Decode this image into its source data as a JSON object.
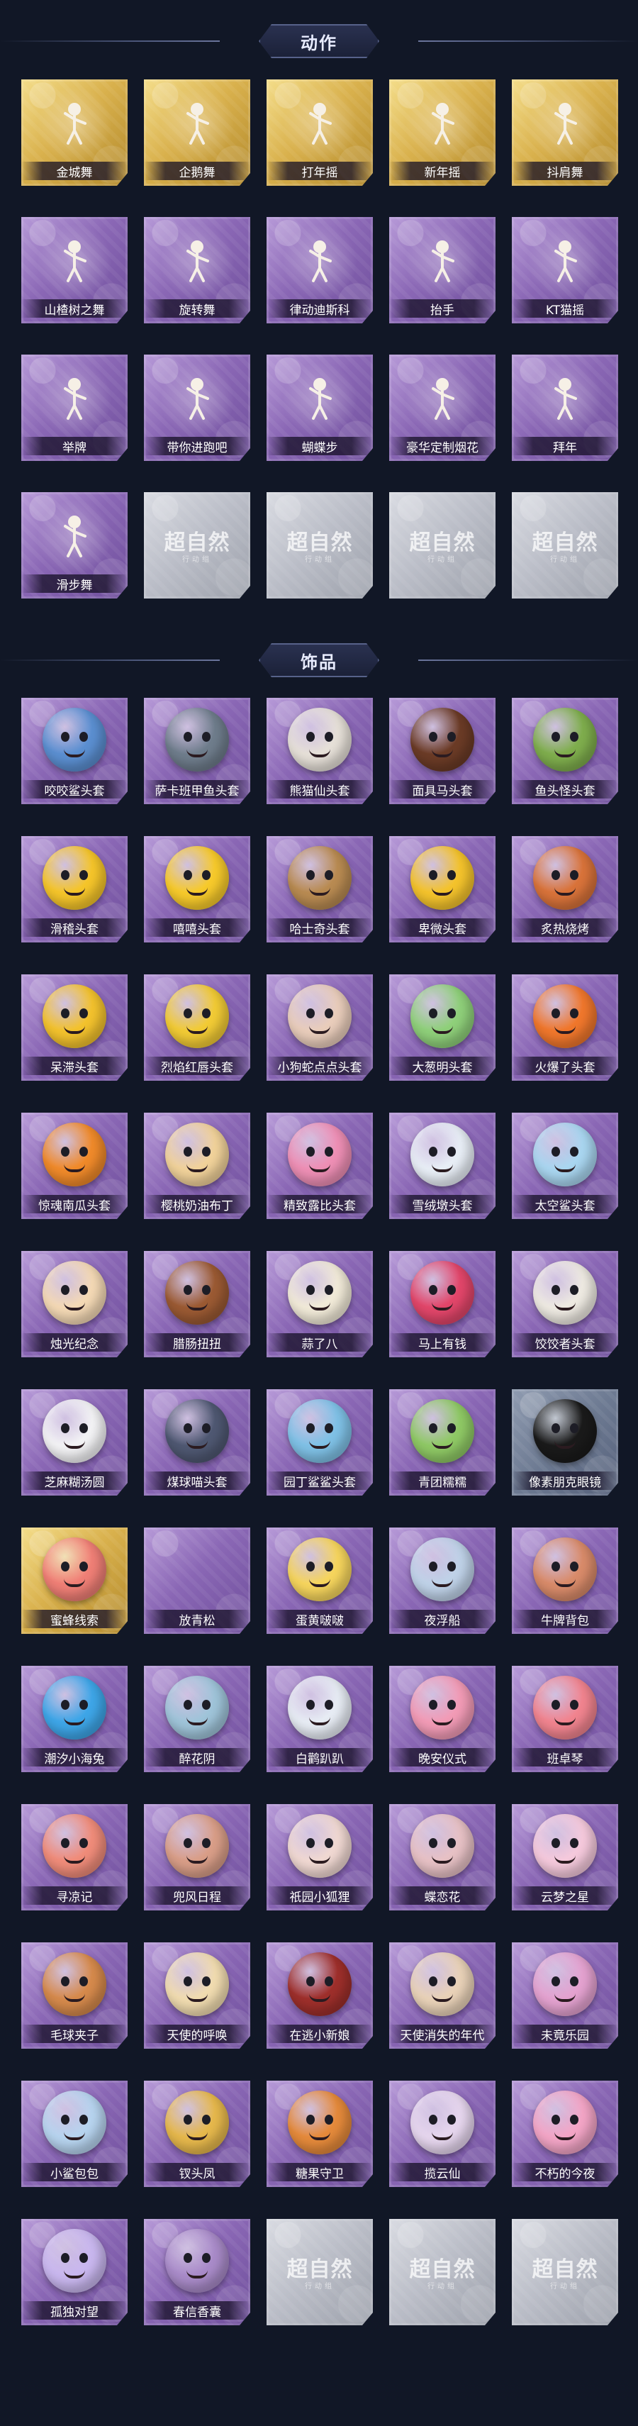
{
  "colors": {
    "background": "#111726",
    "card_purple": "#8a67b5",
    "card_gold": "#d9b14d",
    "card_silver": "#b9bcc6",
    "label_text": "#ffffff"
  },
  "sections": {
    "actions": {
      "title": "动作",
      "items": [
        {
          "label": "金城舞",
          "rarity": "gold",
          "icon": "dance-pose-icon"
        },
        {
          "label": "企鹅舞",
          "rarity": "gold",
          "icon": "penguin-dance-icon"
        },
        {
          "label": "打年摇",
          "rarity": "gold",
          "icon": "dance-pose-icon"
        },
        {
          "label": "新年摇",
          "rarity": "gold",
          "icon": "dance-pose-icon"
        },
        {
          "label": "抖肩舞",
          "rarity": "gold",
          "icon": "dance-pose-icon"
        },
        {
          "label": "山楂树之舞",
          "rarity": "purple",
          "icon": "dance-pose-icon"
        },
        {
          "label": "旋转舞",
          "rarity": "purple",
          "icon": "spin-dance-icon"
        },
        {
          "label": "律动迪斯科",
          "rarity": "purple",
          "icon": "disco-pose-icon"
        },
        {
          "label": "抬手",
          "rarity": "purple",
          "icon": "hand-raise-icon"
        },
        {
          "label": "KT猫摇",
          "rarity": "purple",
          "icon": "dance-pose-icon"
        },
        {
          "label": "举牌",
          "rarity": "purple",
          "icon": "sign-hold-icon"
        },
        {
          "label": "带你进跑吧",
          "rarity": "purple",
          "icon": "run-pose-icon"
        },
        {
          "label": "蝴蝶步",
          "rarity": "purple",
          "icon": "butterfly-step-icon"
        },
        {
          "label": "豪华定制烟花",
          "rarity": "purple",
          "icon": "firework-icon"
        },
        {
          "label": "拜年",
          "rarity": "purple",
          "icon": "bow-pose-icon"
        },
        {
          "label": "滑步舞",
          "rarity": "purple",
          "icon": "slide-dance-icon"
        },
        {
          "label": "",
          "rarity": "silver",
          "icon": "locked-slot",
          "watermark": "超自然",
          "watermark_sub": "行动组"
        },
        {
          "label": "",
          "rarity": "silver",
          "icon": "locked-slot",
          "watermark": "超自然",
          "watermark_sub": "行动组"
        },
        {
          "label": "",
          "rarity": "silver",
          "icon": "locked-slot",
          "watermark": "超自然",
          "watermark_sub": "行动组"
        },
        {
          "label": "",
          "rarity": "silver",
          "icon": "locked-slot",
          "watermark": "超自然",
          "watermark_sub": "行动组"
        }
      ]
    },
    "items": {
      "title": "饰品",
      "items": [
        {
          "label": "咬咬鲨头套",
          "rarity": "purple",
          "icon": "shark-head-icon",
          "tint": "#5b8fd1"
        },
        {
          "label": "萨卡班甲鱼头套",
          "rarity": "purple",
          "icon": "fish-head-icon",
          "tint": "#6f7d8c"
        },
        {
          "label": "熊猫仙头套",
          "rarity": "purple",
          "icon": "panda-head-icon",
          "tint": "#e6e0d8"
        },
        {
          "label": "面具马头套",
          "rarity": "purple",
          "icon": "horse-head-icon",
          "tint": "#6b3b26"
        },
        {
          "label": "鱼头怪头套",
          "rarity": "purple",
          "icon": "fish-monster-icon",
          "tint": "#7fae4d"
        },
        {
          "label": "滑稽头套",
          "rarity": "purple",
          "icon": "smile-emoji-icon",
          "tint": "#f5c52a"
        },
        {
          "label": "嘻嘻头套",
          "rarity": "purple",
          "icon": "grin-emoji-icon",
          "tint": "#f7ca2b"
        },
        {
          "label": "哈士奇头套",
          "rarity": "purple",
          "icon": "husky-head-icon",
          "tint": "#b98b52"
        },
        {
          "label": "卑微头套",
          "rarity": "purple",
          "icon": "sad-emoji-icon",
          "tint": "#f4c32c"
        },
        {
          "label": "炙热烧烤",
          "rarity": "purple",
          "icon": "bbq-head-icon",
          "tint": "#d9733a"
        },
        {
          "label": "呆滞头套",
          "rarity": "purple",
          "icon": "stare-emoji-icon",
          "tint": "#f3c22d"
        },
        {
          "label": "烈焰红唇头套",
          "rarity": "purple",
          "icon": "pika-head-icon",
          "tint": "#f2cb35"
        },
        {
          "label": "小狗蛇点点头套",
          "rarity": "purple",
          "icon": "snake-head-icon",
          "tint": "#e9cdbb"
        },
        {
          "label": "大葱明头套",
          "rarity": "purple",
          "icon": "scallion-head-icon",
          "tint": "#8fd07a"
        },
        {
          "label": "火爆了头套",
          "rarity": "purple",
          "icon": "flame-head-icon",
          "tint": "#f0772c"
        },
        {
          "label": "惊魂南瓜头套",
          "rarity": "purple",
          "icon": "pumpkin-head-icon",
          "tint": "#f08a2a"
        },
        {
          "label": "樱桃奶油布丁",
          "rarity": "purple",
          "icon": "pudding-icon",
          "tint": "#f1d29a"
        },
        {
          "label": "精致露比头套",
          "rarity": "purple",
          "icon": "pink-mascot-icon",
          "tint": "#ee8fb5"
        },
        {
          "label": "雪绒墩头套",
          "rarity": "purple",
          "icon": "snowman-head-icon",
          "tint": "#e8eef6"
        },
        {
          "label": "太空鲨头套",
          "rarity": "purple",
          "icon": "space-shark-icon",
          "tint": "#a9d6f0"
        },
        {
          "label": "烛光纪念",
          "rarity": "purple",
          "icon": "candle-icon",
          "tint": "#f4d9b5"
        },
        {
          "label": "腊肠扭扭",
          "rarity": "purple",
          "icon": "sausage-dog-icon",
          "tint": "#9b5a33"
        },
        {
          "label": "蒜了八",
          "rarity": "purple",
          "icon": "garlic-icon",
          "tint": "#f1ead8"
        },
        {
          "label": "马上有钱",
          "rarity": "purple",
          "icon": "horse-money-icon",
          "tint": "#e2466a"
        },
        {
          "label": "饺饺者头套",
          "rarity": "purple",
          "icon": "dumpling-head-icon",
          "tint": "#eeeae2"
        },
        {
          "label": "芝麻糊汤圆",
          "rarity": "purple",
          "icon": "tangyuan-icon",
          "tint": "#f3f3f5"
        },
        {
          "label": "煤球喵头套",
          "rarity": "purple",
          "icon": "black-cat-icon",
          "tint": "#4f5872"
        },
        {
          "label": "园丁鲨鲨头套",
          "rarity": "purple",
          "icon": "gardener-shark-icon",
          "tint": "#7fc1e6"
        },
        {
          "label": "青团糯糯",
          "rarity": "purple",
          "icon": "qingtuan-icon",
          "tint": "#8fc965"
        },
        {
          "label": "像素朋克眼镜",
          "rarity": "black",
          "icon": "pixel-glasses-icon",
          "tint": "#1a1a1a"
        },
        {
          "label": "蜜蜂线索",
          "rarity": "gold",
          "icon": "bee-mascot-icon",
          "tint": "#f07f76"
        },
        {
          "label": "放青松",
          "rarity": "purple",
          "icon": "empty-art",
          "tint": ""
        },
        {
          "label": "蛋黄啵啵",
          "rarity": "purple",
          "icon": "egg-chick-icon",
          "tint": "#f6d55d"
        },
        {
          "label": "夜浮船",
          "rarity": "purple",
          "icon": "ghost-ship-icon",
          "tint": "#bfd2e8"
        },
        {
          "label": "牛牌背包",
          "rarity": "purple",
          "icon": "backpack-icon",
          "tint": "#d98b6a"
        },
        {
          "label": "潮汐小海兔",
          "rarity": "purple",
          "icon": "sea-rabbit-icon",
          "tint": "#3ea6e8"
        },
        {
          "label": "醉花阴",
          "rarity": "purple",
          "icon": "flower-crown-icon",
          "tint": "#9fc4d9"
        },
        {
          "label": "白鹳趴趴",
          "rarity": "purple",
          "icon": "white-stork-icon",
          "tint": "#e7ecf4"
        },
        {
          "label": "晚安仪式",
          "rarity": "purple",
          "icon": "bunny-doll-icon",
          "tint": "#f29bb6"
        },
        {
          "label": "班卓琴",
          "rarity": "purple",
          "icon": "banjo-mascot-icon",
          "tint": "#f1848f"
        },
        {
          "label": "寻凉记",
          "rarity": "purple",
          "icon": "cool-mascot-icon",
          "tint": "#f08c7a"
        },
        {
          "label": "兜风日程",
          "rarity": "purple",
          "icon": "hat-girl-icon",
          "tint": "#d99e88"
        },
        {
          "label": "祇园小狐狸",
          "rarity": "purple",
          "icon": "fox-doll-icon",
          "tint": "#f0d8d2"
        },
        {
          "label": "蝶恋花",
          "rarity": "purple",
          "icon": "butterfly-charm-icon",
          "tint": "#e7c1c5"
        },
        {
          "label": "云梦之星",
          "rarity": "purple",
          "icon": "unicorn-doll-icon",
          "tint": "#f5c9dc"
        },
        {
          "label": "毛球夹子",
          "rarity": "purple",
          "icon": "raccoon-clip-icon",
          "tint": "#d68a4c"
        },
        {
          "label": "天使的呼唤",
          "rarity": "purple",
          "icon": "angel-doll-icon",
          "tint": "#f1dcb0"
        },
        {
          "label": "在逃小新娘",
          "rarity": "purple",
          "icon": "bride-doll-icon",
          "tint": "#9e2f2b"
        },
        {
          "label": "天使消失的年代",
          "rarity": "purple",
          "icon": "angel-girl-icon",
          "tint": "#e9d2b8"
        },
        {
          "label": "未竟乐园",
          "rarity": "purple",
          "icon": "clown-doll-icon",
          "tint": "#e4a2d0"
        },
        {
          "label": "小鲨包包",
          "rarity": "purple",
          "icon": "shark-bag-icon",
          "tint": "#b7d4ef"
        },
        {
          "label": "钗头凤",
          "rarity": "purple",
          "icon": "phoenix-hairpin-icon",
          "tint": "#e6b84c"
        },
        {
          "label": "糖果守卫",
          "rarity": "purple",
          "icon": "candy-guard-icon",
          "tint": "#e58a3b"
        },
        {
          "label": "揽云仙",
          "rarity": "purple",
          "icon": "cloud-fairy-icon",
          "tint": "#e6d6ee"
        },
        {
          "label": "不朽的今夜",
          "rarity": "purple",
          "icon": "pink-keychain-icon",
          "tint": "#f3a5c6"
        },
        {
          "label": "孤独对望",
          "rarity": "purple",
          "icon": "crystal-charm-icon",
          "tint": "#c9b7ef"
        },
        {
          "label": "春信香囊",
          "rarity": "purple",
          "icon": "sachet-icon",
          "tint": "#a98bc9"
        },
        {
          "label": "",
          "rarity": "silver",
          "icon": "locked-slot",
          "tint": "",
          "watermark": "超自然",
          "watermark_sub": "行动组"
        },
        {
          "label": "",
          "rarity": "silver",
          "icon": "locked-slot",
          "tint": "",
          "watermark": "超自然",
          "watermark_sub": "行动组"
        },
        {
          "label": "",
          "rarity": "silver",
          "icon": "locked-slot",
          "tint": "",
          "watermark": "超自然",
          "watermark_sub": "行动组"
        }
      ]
    }
  }
}
